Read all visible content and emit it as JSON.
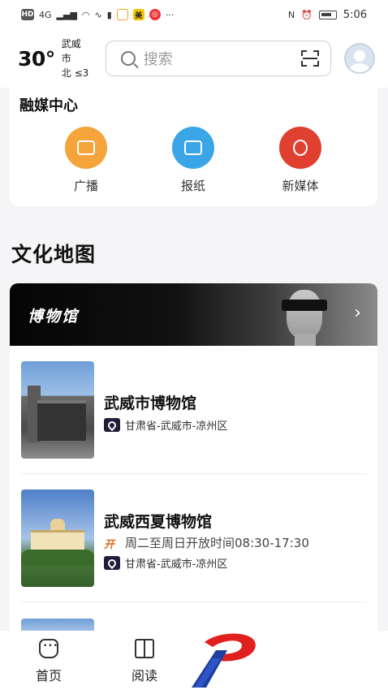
{
  "status_bar": {
    "network": "4G",
    "time": "5:06",
    "badges": [
      "HD",
      "美"
    ]
  },
  "header": {
    "temperature": "30°",
    "city": "武威市",
    "wind": "北 ≤3",
    "search_placeholder": "搜索",
    "icons": [
      "search-icon",
      "scan-icon",
      "avatar"
    ]
  },
  "media_center": {
    "title": "融媒中心",
    "items": [
      {
        "label": "广播",
        "icon": "radio-icon",
        "color": "#f5a43c"
      },
      {
        "label": "报纸",
        "icon": "newspaper-icon",
        "color": "#3aa6e8"
      },
      {
        "label": "新媒体",
        "icon": "new-media-icon",
        "color": "#e0402f"
      }
    ]
  },
  "culture_map": {
    "section_title": "文化地图",
    "banner_title": "博物馆",
    "museums": [
      {
        "name": "武威市博物馆",
        "location": "甘肃省-武威市-凉州区"
      },
      {
        "name": "武威西夏博物馆",
        "hours": "周二至周日开放时间08:30-17:30",
        "location": "甘肃省-武威市-凉州区"
      }
    ]
  },
  "bottom_nav": {
    "items": [
      {
        "label": "首页",
        "icon": "home-icon"
      },
      {
        "label": "阅读",
        "icon": "read-icon"
      }
    ],
    "logo": "brand-logo"
  },
  "colors": {
    "accent_red": "#e0201f",
    "accent_blue": "#1f3fa0",
    "open_icon": "#e06a1f"
  }
}
